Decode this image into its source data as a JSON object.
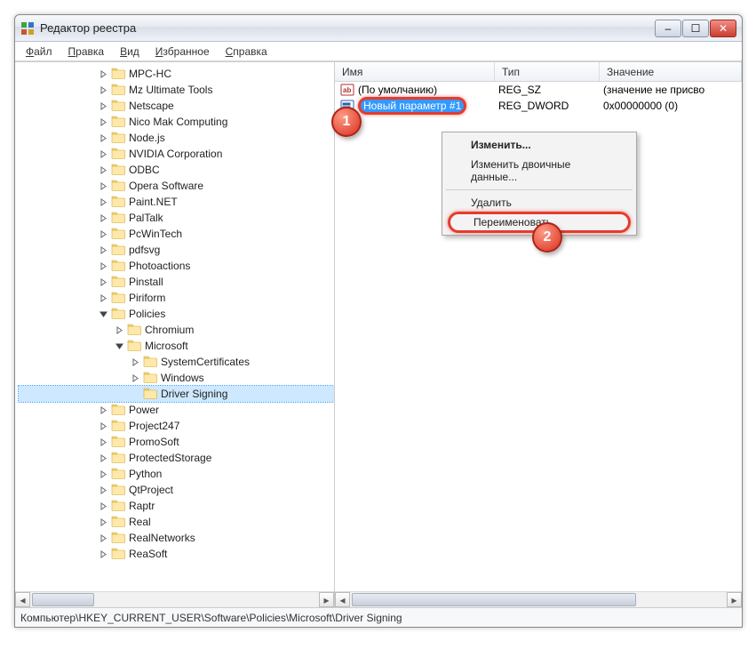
{
  "window": {
    "title": "Редактор реестра"
  },
  "win_controls": {
    "min": "–",
    "max": "☐",
    "close": "✕"
  },
  "menus": [
    {
      "label": "Файл",
      "u": "Ф"
    },
    {
      "label": "Правка",
      "u": "П"
    },
    {
      "label": "Вид",
      "u": "В"
    },
    {
      "label": "Избранное",
      "u": "И"
    },
    {
      "label": "Справка",
      "u": "С"
    }
  ],
  "columns": {
    "name": "Имя",
    "type": "Тип",
    "value": "Значение"
  },
  "values_rows": [
    {
      "icon": "ab",
      "name": "(По умолчанию)",
      "type": "REG_SZ",
      "value": "(значение не присво"
    },
    {
      "icon": "dw",
      "name": "Новый параметр #1",
      "type": "REG_DWORD",
      "value": "0x00000000 (0)",
      "editing": true
    }
  ],
  "context_menu": {
    "items": [
      {
        "label": "Изменить...",
        "bold": true
      },
      {
        "label": "Изменить двоичные данные..."
      },
      {
        "sep": true
      },
      {
        "label": "Удалить"
      },
      {
        "label": "Переименовать",
        "highlight": true
      }
    ]
  },
  "badges": {
    "one": "1",
    "two": "2"
  },
  "tree": [
    {
      "d": 0,
      "expandable": true,
      "name": "MPC-HC"
    },
    {
      "d": 0,
      "expandable": true,
      "name": "Mz Ultimate Tools"
    },
    {
      "d": 0,
      "expandable": true,
      "name": "Netscape"
    },
    {
      "d": 0,
      "expandable": true,
      "name": "Nico Mak Computing"
    },
    {
      "d": 0,
      "expandable": true,
      "name": "Node.js"
    },
    {
      "d": 0,
      "expandable": true,
      "name": "NVIDIA Corporation"
    },
    {
      "d": 0,
      "expandable": true,
      "name": "ODBC"
    },
    {
      "d": 0,
      "expandable": true,
      "name": "Opera Software"
    },
    {
      "d": 0,
      "expandable": true,
      "name": "Paint.NET"
    },
    {
      "d": 0,
      "expandable": true,
      "name": "PalTalk"
    },
    {
      "d": 0,
      "expandable": true,
      "name": "PcWinTech"
    },
    {
      "d": 0,
      "expandable": true,
      "name": "pdfsvg"
    },
    {
      "d": 0,
      "expandable": true,
      "name": "Photoactions"
    },
    {
      "d": 0,
      "expandable": true,
      "name": "Pinstall"
    },
    {
      "d": 0,
      "expandable": true,
      "name": "Piriform"
    },
    {
      "d": 0,
      "expandable": true,
      "open": true,
      "name": "Policies"
    },
    {
      "d": 1,
      "expandable": true,
      "name": "Chromium"
    },
    {
      "d": 1,
      "expandable": true,
      "open": true,
      "name": "Microsoft"
    },
    {
      "d": 2,
      "expandable": true,
      "name": "SystemCertificates"
    },
    {
      "d": 2,
      "expandable": true,
      "name": "Windows"
    },
    {
      "d": 2,
      "expandable": false,
      "name": "Driver Signing",
      "selected": true
    },
    {
      "d": 0,
      "expandable": true,
      "name": "Power"
    },
    {
      "d": 0,
      "expandable": true,
      "name": "Project247"
    },
    {
      "d": 0,
      "expandable": true,
      "name": "PromoSoft"
    },
    {
      "d": 0,
      "expandable": true,
      "name": "ProtectedStorage"
    },
    {
      "d": 0,
      "expandable": true,
      "name": "Python"
    },
    {
      "d": 0,
      "expandable": true,
      "name": "QtProject"
    },
    {
      "d": 0,
      "expandable": true,
      "name": "Raptr"
    },
    {
      "d": 0,
      "expandable": true,
      "name": "Real"
    },
    {
      "d": 0,
      "expandable": true,
      "name": "RealNetworks"
    },
    {
      "d": 0,
      "expandable": true,
      "name": "ReaSoft"
    }
  ],
  "statusbar": "Компьютер\\HKEY_CURRENT_USER\\Software\\Policies\\Microsoft\\Driver Signing"
}
